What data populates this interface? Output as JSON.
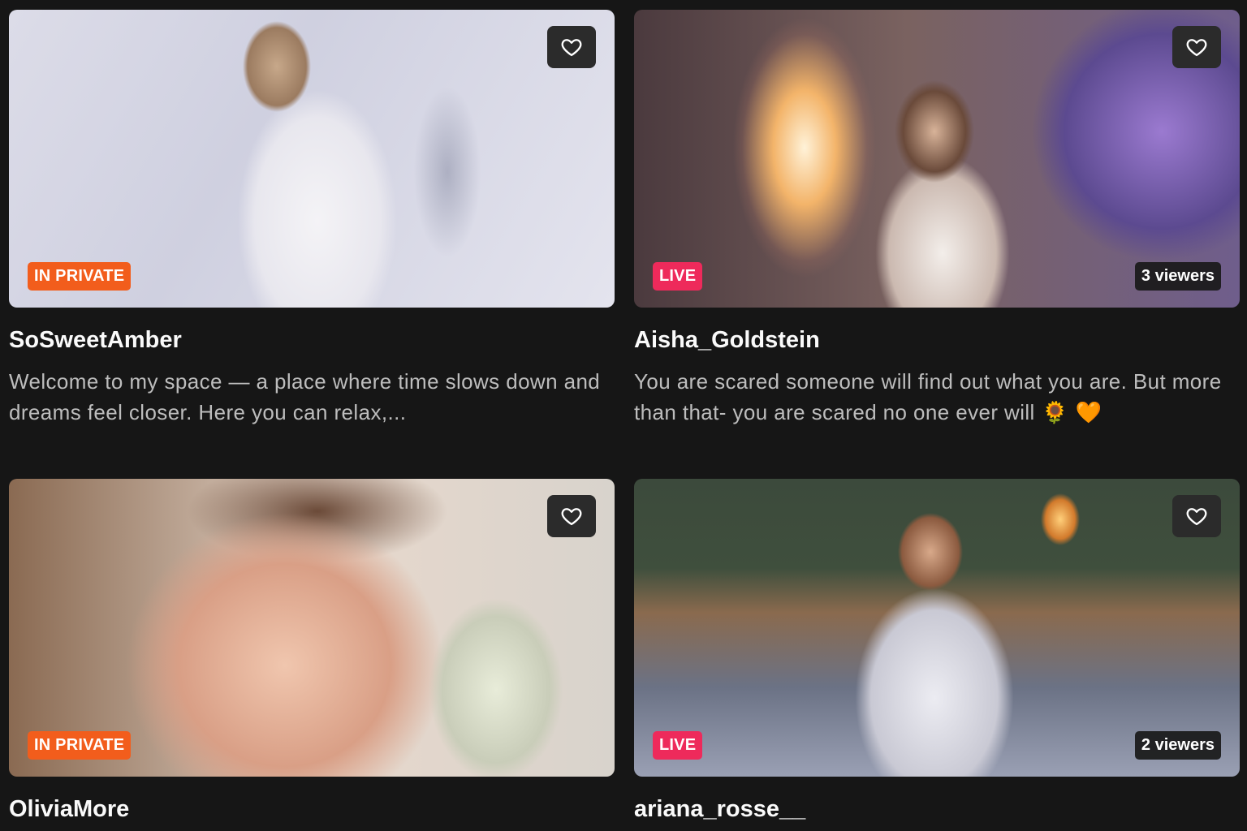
{
  "cards": [
    {
      "name": "SoSweetAmber",
      "badge": "IN PRIVATE",
      "badge_type": "private",
      "viewers": "",
      "description": "Welcome to my space — a place where time slows down and dreams feel closer. Here you can relax,...",
      "description_emoji": ""
    },
    {
      "name": "Aisha_Goldstein",
      "badge": "LIVE",
      "badge_type": "live",
      "viewers": "3 viewers",
      "description": "You are scared someone will find out what you are. But more than that- you are scared no one ever will",
      "description_emoji": " 🌻 🧡"
    },
    {
      "name": "OliviaMore",
      "badge": "IN PRIVATE",
      "badge_type": "private",
      "viewers": "",
      "description": "",
      "description_emoji": ""
    },
    {
      "name": "ariana_rosse__",
      "badge": "LIVE",
      "badge_type": "live",
      "viewers": "2 viewers",
      "description": "",
      "description_emoji": ""
    }
  ],
  "icons": {
    "favorite": "heart-outline-icon"
  },
  "colors": {
    "background": "#161616",
    "private_badge": "#f25d1c",
    "live_badge": "#ee2a5b"
  }
}
